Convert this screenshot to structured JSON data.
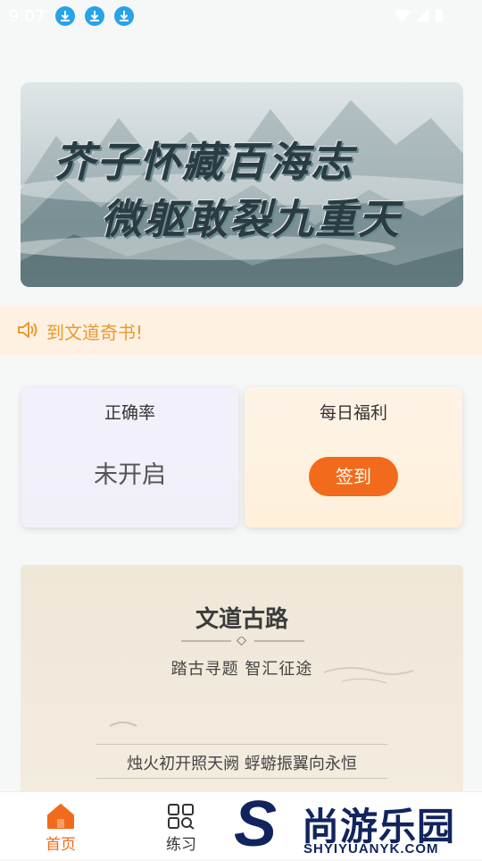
{
  "status": {
    "time": "9:07"
  },
  "banner": {
    "line1": "芥子怀藏百海志",
    "line2": "微躯敢裂九重天"
  },
  "notice": {
    "text": "到文道奇书!"
  },
  "cards": {
    "accuracy": {
      "title": "正确率",
      "value": "未开启"
    },
    "bonus": {
      "title": "每日福利",
      "button": "签到"
    }
  },
  "road": {
    "title": "文道古路",
    "subtitle": "踏古寻题   智汇征途",
    "poem": "烛火初开照天阙  蜉蝣振翼向永恒"
  },
  "tabs": [
    {
      "label": "首页",
      "icon": "home-icon"
    },
    {
      "label": "练习",
      "icon": "grid-search-icon"
    }
  ],
  "watermark": {
    "cn": "尚游乐园",
    "en": "SHYIYUANYK.COM"
  },
  "colors": {
    "accent": "#f26a1b",
    "notice": "#e89a2d",
    "download": "#27a3e8"
  }
}
